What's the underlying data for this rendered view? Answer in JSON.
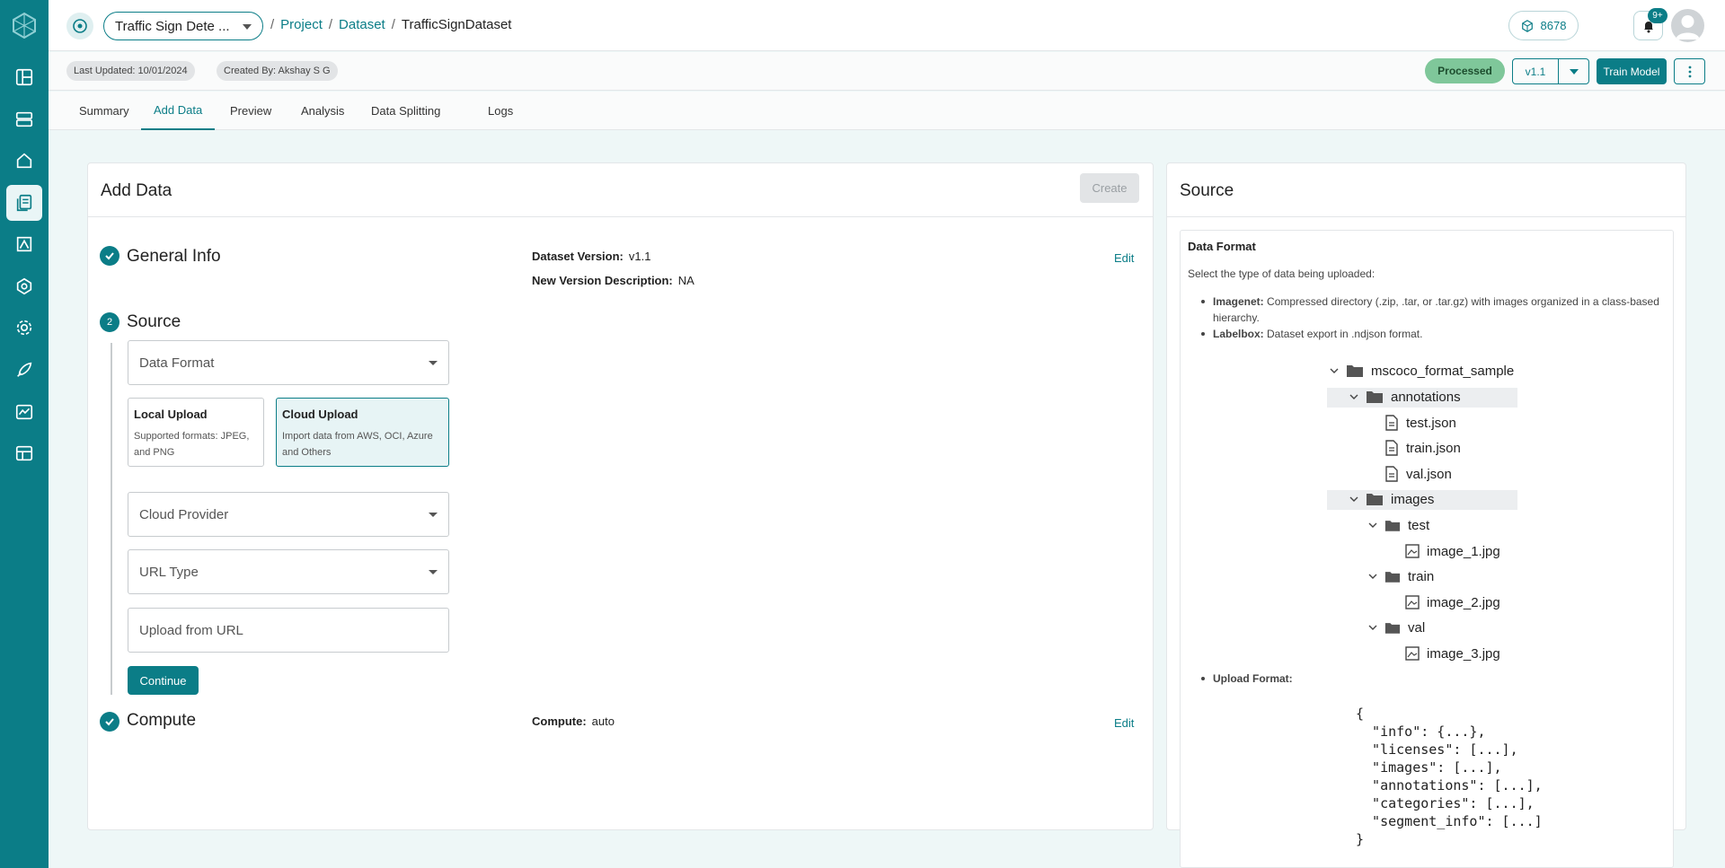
{
  "header": {
    "project_name": "Traffic Sign Dete ...",
    "breadcrumbs": [
      "Project",
      "Dataset",
      "TrafficSignDataset"
    ],
    "credits": "8678",
    "notifications_badge": "9+"
  },
  "subheader": {
    "last_updated": "Last Updated: 10/01/2024",
    "created_by": "Created By: Akshay S G",
    "status": "Processed",
    "version": "v1.1",
    "train_label": "Train Model"
  },
  "tabs": [
    "Summary",
    "Add Data",
    "Preview",
    "Analysis",
    "Data Splitting",
    "Logs"
  ],
  "add_data": {
    "title": "Add Data",
    "create_label": "Create",
    "general": {
      "title": "General Info",
      "dataset_version_label": "Dataset Version:",
      "dataset_version": "v1.1",
      "desc_label": "New Version Description:",
      "desc": "NA",
      "edit": "Edit"
    },
    "source": {
      "step": "2",
      "title": "Source",
      "data_format_placeholder": "Data Format",
      "local": {
        "title": "Local Upload",
        "desc": "Supported formats: JPEG, and PNG"
      },
      "cloud": {
        "title": "Cloud Upload",
        "desc": "Import data from AWS, OCI, Azure and Others"
      },
      "cloud_provider_placeholder": "Cloud Provider",
      "url_type_placeholder": "URL Type",
      "url_placeholder": "Upload from URL",
      "continue_label": "Continue"
    },
    "compute": {
      "title": "Compute",
      "label": "Compute:",
      "value": "auto",
      "edit": "Edit"
    }
  },
  "source_panel": {
    "title": "Source",
    "data_format_title": "Data Format",
    "data_format_sub": "Select the type of data being uploaded:",
    "imagenet_label": "Imagenet:",
    "imagenet_desc": "Compressed directory (.zip, .tar, or .tar.gz) with images organized in a class-based hierarchy.",
    "labelbox_label": "Labelbox:",
    "labelbox_desc": "Dataset export in .ndjson format.",
    "tree": {
      "root": "mscoco_format_sample",
      "annotations": "annotations",
      "test_json": "test.json",
      "train_json": "train.json",
      "val_json": "val.json",
      "images": "images",
      "test": "test",
      "image_1": "image_1.jpg",
      "train": "train",
      "image_2": "image_2.jpg",
      "val": "val",
      "image_3": "image_3.jpg"
    },
    "upload_format_label": "Upload Format:",
    "code": "{\n  \"info\": {...},\n  \"licenses\": [...],\n  \"images\": [...],\n  \"annotations\": [...],\n  \"categories\": [...],\n  \"segment_info\": [...]\n}"
  },
  "colors": {
    "brand": "#0b7d87",
    "processed": "#7fc79a"
  }
}
